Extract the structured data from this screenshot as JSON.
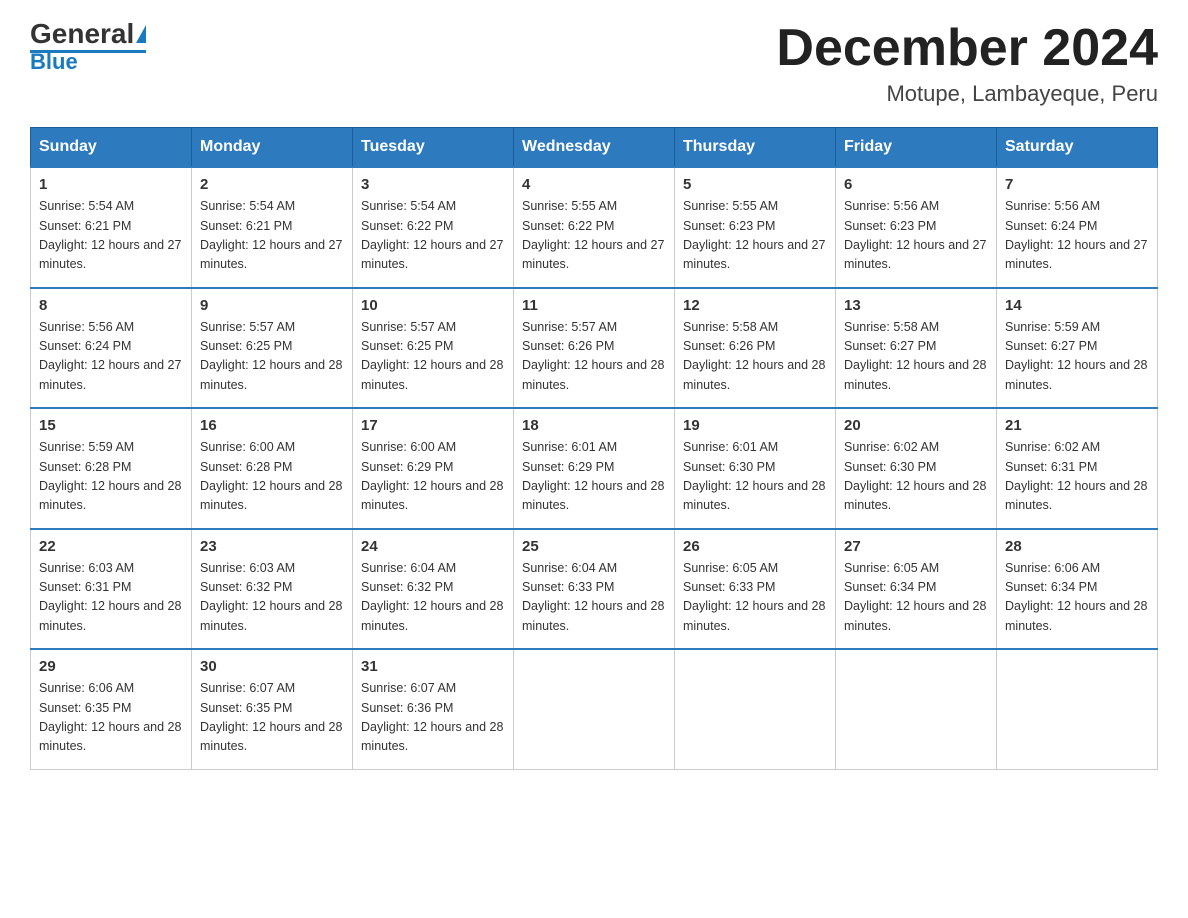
{
  "logo": {
    "general": "General",
    "blue": "Blue"
  },
  "title": "December 2024",
  "subtitle": "Motupe, Lambayeque, Peru",
  "days_of_week": [
    "Sunday",
    "Monday",
    "Tuesday",
    "Wednesday",
    "Thursday",
    "Friday",
    "Saturday"
  ],
  "weeks": [
    [
      {
        "day": "1",
        "sunrise": "5:54 AM",
        "sunset": "6:21 PM",
        "daylight": "12 hours and 27 minutes."
      },
      {
        "day": "2",
        "sunrise": "5:54 AM",
        "sunset": "6:21 PM",
        "daylight": "12 hours and 27 minutes."
      },
      {
        "day": "3",
        "sunrise": "5:54 AM",
        "sunset": "6:22 PM",
        "daylight": "12 hours and 27 minutes."
      },
      {
        "day": "4",
        "sunrise": "5:55 AM",
        "sunset": "6:22 PM",
        "daylight": "12 hours and 27 minutes."
      },
      {
        "day": "5",
        "sunrise": "5:55 AM",
        "sunset": "6:23 PM",
        "daylight": "12 hours and 27 minutes."
      },
      {
        "day": "6",
        "sunrise": "5:56 AM",
        "sunset": "6:23 PM",
        "daylight": "12 hours and 27 minutes."
      },
      {
        "day": "7",
        "sunrise": "5:56 AM",
        "sunset": "6:24 PM",
        "daylight": "12 hours and 27 minutes."
      }
    ],
    [
      {
        "day": "8",
        "sunrise": "5:56 AM",
        "sunset": "6:24 PM",
        "daylight": "12 hours and 27 minutes."
      },
      {
        "day": "9",
        "sunrise": "5:57 AM",
        "sunset": "6:25 PM",
        "daylight": "12 hours and 28 minutes."
      },
      {
        "day": "10",
        "sunrise": "5:57 AM",
        "sunset": "6:25 PM",
        "daylight": "12 hours and 28 minutes."
      },
      {
        "day": "11",
        "sunrise": "5:57 AM",
        "sunset": "6:26 PM",
        "daylight": "12 hours and 28 minutes."
      },
      {
        "day": "12",
        "sunrise": "5:58 AM",
        "sunset": "6:26 PM",
        "daylight": "12 hours and 28 minutes."
      },
      {
        "day": "13",
        "sunrise": "5:58 AM",
        "sunset": "6:27 PM",
        "daylight": "12 hours and 28 minutes."
      },
      {
        "day": "14",
        "sunrise": "5:59 AM",
        "sunset": "6:27 PM",
        "daylight": "12 hours and 28 minutes."
      }
    ],
    [
      {
        "day": "15",
        "sunrise": "5:59 AM",
        "sunset": "6:28 PM",
        "daylight": "12 hours and 28 minutes."
      },
      {
        "day": "16",
        "sunrise": "6:00 AM",
        "sunset": "6:28 PM",
        "daylight": "12 hours and 28 minutes."
      },
      {
        "day": "17",
        "sunrise": "6:00 AM",
        "sunset": "6:29 PM",
        "daylight": "12 hours and 28 minutes."
      },
      {
        "day": "18",
        "sunrise": "6:01 AM",
        "sunset": "6:29 PM",
        "daylight": "12 hours and 28 minutes."
      },
      {
        "day": "19",
        "sunrise": "6:01 AM",
        "sunset": "6:30 PM",
        "daylight": "12 hours and 28 minutes."
      },
      {
        "day": "20",
        "sunrise": "6:02 AM",
        "sunset": "6:30 PM",
        "daylight": "12 hours and 28 minutes."
      },
      {
        "day": "21",
        "sunrise": "6:02 AM",
        "sunset": "6:31 PM",
        "daylight": "12 hours and 28 minutes."
      }
    ],
    [
      {
        "day": "22",
        "sunrise": "6:03 AM",
        "sunset": "6:31 PM",
        "daylight": "12 hours and 28 minutes."
      },
      {
        "day": "23",
        "sunrise": "6:03 AM",
        "sunset": "6:32 PM",
        "daylight": "12 hours and 28 minutes."
      },
      {
        "day": "24",
        "sunrise": "6:04 AM",
        "sunset": "6:32 PM",
        "daylight": "12 hours and 28 minutes."
      },
      {
        "day": "25",
        "sunrise": "6:04 AM",
        "sunset": "6:33 PM",
        "daylight": "12 hours and 28 minutes."
      },
      {
        "day": "26",
        "sunrise": "6:05 AM",
        "sunset": "6:33 PM",
        "daylight": "12 hours and 28 minutes."
      },
      {
        "day": "27",
        "sunrise": "6:05 AM",
        "sunset": "6:34 PM",
        "daylight": "12 hours and 28 minutes."
      },
      {
        "day": "28",
        "sunrise": "6:06 AM",
        "sunset": "6:34 PM",
        "daylight": "12 hours and 28 minutes."
      }
    ],
    [
      {
        "day": "29",
        "sunrise": "6:06 AM",
        "sunset": "6:35 PM",
        "daylight": "12 hours and 28 minutes."
      },
      {
        "day": "30",
        "sunrise": "6:07 AM",
        "sunset": "6:35 PM",
        "daylight": "12 hours and 28 minutes."
      },
      {
        "day": "31",
        "sunrise": "6:07 AM",
        "sunset": "6:36 PM",
        "daylight": "12 hours and 28 minutes."
      },
      null,
      null,
      null,
      null
    ]
  ]
}
